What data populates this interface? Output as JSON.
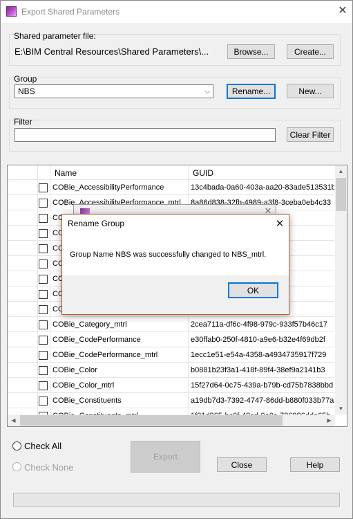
{
  "window": {
    "title": "Export Shared Parameters",
    "close_glyph": "✕"
  },
  "shared_file": {
    "label": "Shared parameter file:",
    "path": "E:\\BIM Central Resources\\Shared Parameters\\...",
    "browse_label": "Browse...",
    "create_label": "Create..."
  },
  "group": {
    "label": "Group",
    "selected": "NBS",
    "rename_label": "Rename...",
    "new_label": "New..."
  },
  "filter": {
    "label": "Filter",
    "value": "",
    "clear_label": "Clear Filter"
  },
  "grid": {
    "columns": [
      "Name",
      "GUID"
    ],
    "rows": [
      {
        "name": "COBie_AccessibilityPerformance",
        "guid": "13c4bada-0a60-403a-aa20-83ade513531b"
      },
      {
        "name": "COBie_AccessibilityPerformance_mtrl",
        "guid": "8a86d838-32fb-4989-a3f8-3ceba0eb4c33"
      },
      {
        "name": "CO",
        "guid": "773fdf142"
      },
      {
        "name": "CO",
        "guid": "eede7f0d9"
      },
      {
        "name": "CO",
        "guid": "5d11d8005"
      },
      {
        "name": "CO",
        "guid": "62f7aef1"
      },
      {
        "name": "CO",
        "guid": "d5b4be2fa"
      },
      {
        "name": "CO",
        "guid": "241c581c"
      },
      {
        "name": "COBie_",
        "guid": "ed2858ce57060"
      },
      {
        "name": "COBie_Category_mtrl",
        "guid": "2cea711a-df6c-4f98-979c-933f57b46c17"
      },
      {
        "name": "COBie_CodePerformance",
        "guid": "e30ffab0-250f-4810-a9e6-b32e4f69db2f"
      },
      {
        "name": "COBie_CodePerformance_mtrl",
        "guid": "1ecc1e51-e54a-4358-a4934735917f729"
      },
      {
        "name": "COBie_Color",
        "guid": "b0881b23f3a1-418f-89f4-38ef9a2141b3"
      },
      {
        "name": "COBie_Color_mtrl",
        "guid": "15f27d64-0c75-439a-b79b-cd75b7838bbd"
      },
      {
        "name": "COBie_Constituents",
        "guid": "a19db7d3-7392-4747-86dd-b880f033b77a"
      },
      {
        "name": "COBie_Constituents_mtrl",
        "guid": "1f21d865-bc0f-48cd-9e0c-786986dde65b"
      }
    ]
  },
  "selection": {
    "check_all_label": "Check All",
    "check_none_label": "Check None"
  },
  "footer": {
    "export_label": "Export",
    "close_label": "Close",
    "help_label": "Help"
  },
  "dialog": {
    "title": "Rename Group",
    "message": "Group Name NBS was successfully changed to NBS_mtrl.",
    "ok_label": "OK",
    "close_glyph": "✕"
  },
  "colors": {
    "accent": "#0078d7",
    "dialog_border": "#b45a1e",
    "brand": "#9b3fb0"
  }
}
